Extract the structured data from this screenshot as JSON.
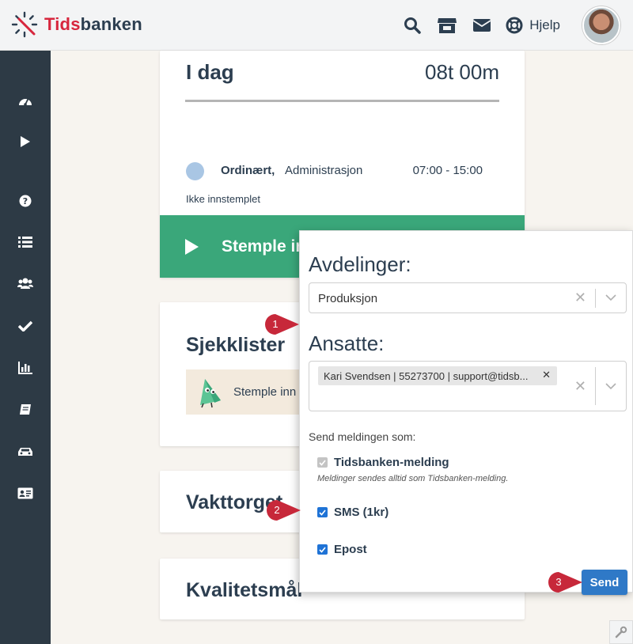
{
  "header": {
    "logo_part1": "Tids",
    "logo_part2": "banken",
    "help_label": "Hjelp",
    "icons": [
      "search-icon",
      "store-icon",
      "mail-icon",
      "lifebuoy-icon"
    ]
  },
  "sidebar": {
    "icons": [
      "dashboard-icon",
      "play-icon",
      "help-icon",
      "list-icon",
      "users-icon",
      "check-icon",
      "chart-icon",
      "book-icon",
      "car-icon",
      "id-card-icon"
    ]
  },
  "today": {
    "title": "I dag",
    "hours": "08t 00m",
    "shift_type": "Ordinært,",
    "shift_department": "Administrasjon",
    "shift_time": "07:00 - 15:00",
    "status": "Ikke innstemplet",
    "stamp_button": "Stemple inn"
  },
  "checklists": {
    "title": "Sjekklister",
    "item_label": "Stemple inn"
  },
  "shift_card": {
    "title": "Vakttorget"
  },
  "quality_card": {
    "title": "Kvalitetsmål"
  },
  "popup": {
    "departments_label": "Avdelinger:",
    "department_value": "Produksjon",
    "employees_label": "Ansatte:",
    "employee_tag": "Kari Svendsen | 55273700 | support@tidsb...",
    "send_as_label": "Send meldingen som:",
    "options": [
      {
        "label": "Tidsbanken-melding",
        "checked": true,
        "disabled": true
      },
      {
        "label": "SMS (1kr)",
        "checked": true,
        "disabled": false
      },
      {
        "label": "Epost",
        "checked": true,
        "disabled": false
      }
    ],
    "note": "Meldinger sendes alltid som Tidsbanken-melding.",
    "send_button": "Send"
  },
  "callouts": [
    "1",
    "2",
    "3"
  ],
  "colors": {
    "sidebar": "#2d3a45",
    "stamp_green": "#3aa77a",
    "send_blue": "#2f79c7",
    "callout_red": "#c7283a",
    "brand_red": "#d7263d"
  }
}
